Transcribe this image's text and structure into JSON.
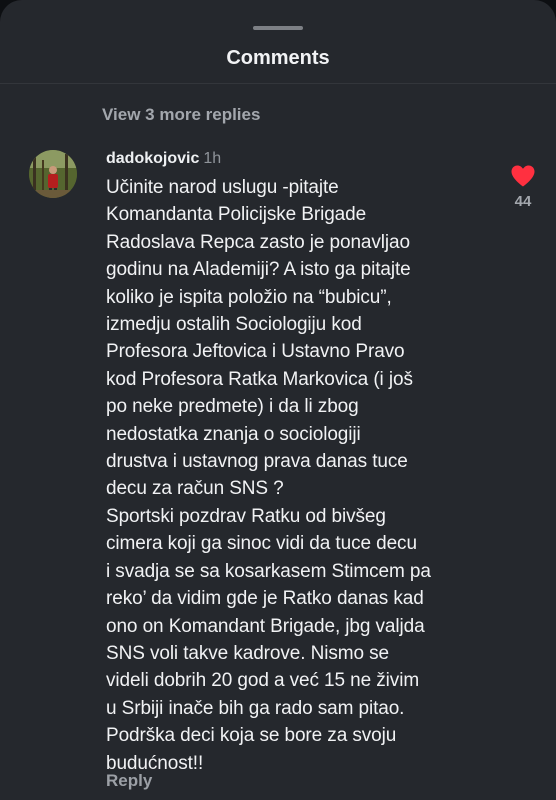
{
  "sheet": {
    "title": "Comments"
  },
  "thread": {
    "view_more_label": "View 3 more replies"
  },
  "comment": {
    "username": "dadokojovic",
    "time": "1h",
    "text": "Učinite narod uslugu -pitajte\nKomandanta Policijske Brigade\nRadoslava Repca zasto je ponavljao\ngodinu na Alademiji? A isto ga pitajte\nkoliko je ispita položio na “bubicu”,\nizmedju ostalih Sociologiju kod\nProfesora Jeftovica i Ustavno Pravo\nkod Profesora Ratka Markovica (i još\npo neke predmete) i da li zbog\nnedostatka znanja o sociologiji\ndrustva i ustavnog prava danas tuce\ndecu za račun SNS ?\nSportski pozdrav Ratku od bivšeg\ncimera koji ga sinoc vidi da tuce decu\ni svadja se sa kosarkasem Stimcem pa\nreko’ da vidim gde je Ratko danas kad\nono on Komandant Brigade, jbg valjda\nSNS voli takve kadrove. Nismo se\nvideli dobrih 20 god a već 15 ne živim\nu Srbiji inače bih ga rado sam pitao.\nPodrška deci koja se bore za svoju\nbudućnost!!",
    "like_count": "44",
    "liked": true,
    "reply_label": "Reply"
  },
  "colors": {
    "background": "#25282d",
    "heart": "#ff3040",
    "muted_text": "#a3a7ad",
    "primary_text": "#f1f2f4"
  },
  "icons": {
    "like": "heart-filled-icon",
    "grabber": "drag-handle-icon"
  }
}
